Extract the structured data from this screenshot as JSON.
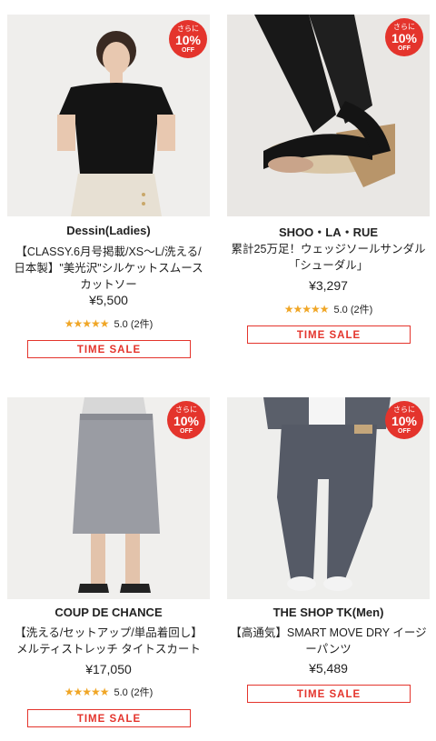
{
  "badge": {
    "line1": "さらに",
    "line2": "10%",
    "line3": "OFF"
  },
  "products": [
    {
      "brand": "Dessin(Ladies)",
      "title_lines": [
        "【CLASSY.6月号掲載/XS〜L/洗える/",
        "日本製】\"美光沢\"シルケットスムース",
        "カットソー"
      ],
      "price": "¥5,500",
      "rating": "5.0 (2件)",
      "sale": "TIME SALE"
    },
    {
      "brand": "SHOO・LA・RUE",
      "title_lines": [
        "累計25万足！ウェッジソールサンダル",
        "「シューダル」"
      ],
      "price": "¥3,297",
      "rating": "5.0 (2件)",
      "sale": "TIME SALE"
    },
    {
      "brand": "COUP DE CHANCE",
      "title_lines": [
        "【洗える/セットアップ/単品着回し】",
        "メルティストレッチ タイトスカート"
      ],
      "price": "¥17,050",
      "rating": "5.0 (2件)",
      "sale": "TIME SALE"
    },
    {
      "brand": "THE SHOP TK(Men)",
      "title_lines": [
        "【高通気】SMART MOVE DRY イージ",
        "ーパンツ"
      ],
      "price": "¥5,489",
      "rating": "",
      "sale": "TIME SALE"
    }
  ],
  "colors": {
    "accent": "#e4342c",
    "star": "#f0a626"
  },
  "icons": {
    "star": "star-icon"
  }
}
